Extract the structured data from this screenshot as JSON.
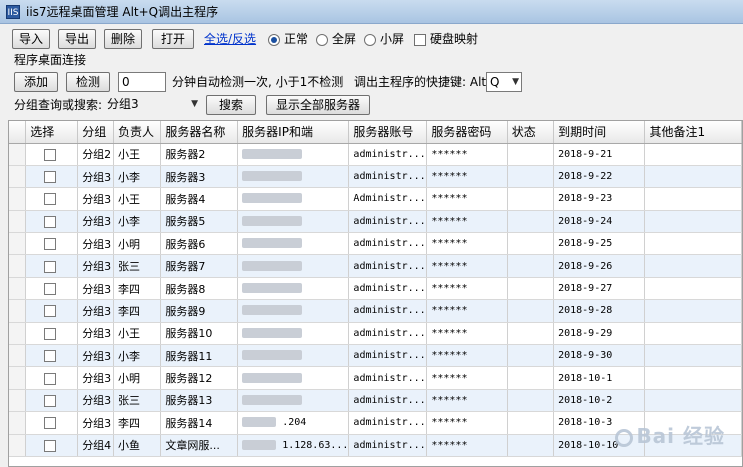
{
  "window": {
    "title": "iis7远程桌面管理 Alt+Q调出主程序",
    "icon": "app-icon"
  },
  "toolbar": {
    "import": "导入",
    "export": "导出",
    "delete": "删除",
    "open": "打开",
    "select_all": "全选/反选",
    "modes": [
      {
        "label": "正常",
        "selected": true
      },
      {
        "label": "全屏",
        "selected": false
      },
      {
        "label": "小屏",
        "selected": false
      }
    ],
    "disk_map": "硬盘映射"
  },
  "section": {
    "title": "程序桌面连接"
  },
  "row2": {
    "add": "添加",
    "check": "检测",
    "interval_value": "0",
    "interval_text": "分钟自动检测一次, 小于1不检测",
    "hotkey_text": "调出主程序的快捷键: Alt",
    "hotkey_value": "Q"
  },
  "row3": {
    "search_label": "分组查询或搜索:",
    "search_value": "分组3",
    "search_btn": "搜索",
    "show_all_btn": "显示全部服务器"
  },
  "table": {
    "headers": [
      "选择",
      "分组",
      "负责人",
      "服务器名称",
      "服务器IP和端",
      "服务器账号",
      "服务器密码",
      "状态",
      "到期时间",
      "其他备注1"
    ],
    "rows": [
      {
        "group": "分组2",
        "owner": "小王",
        "name": "服务器2",
        "ip": "",
        "account": "administr...",
        "password": "******",
        "status": "",
        "expire": "2018-9-21",
        "note": ""
      },
      {
        "group": "分组3",
        "owner": "小李",
        "name": "服务器3",
        "ip": "",
        "account": "administr...",
        "password": "******",
        "status": "",
        "expire": "2018-9-22",
        "note": ""
      },
      {
        "group": "分组3",
        "owner": "小王",
        "name": "服务器4",
        "ip": "",
        "account": "Administr...",
        "password": "******",
        "status": "",
        "expire": "2018-9-23",
        "note": ""
      },
      {
        "group": "分组3",
        "owner": "小李",
        "name": "服务器5",
        "ip": "",
        "account": "administr...",
        "password": "******",
        "status": "",
        "expire": "2018-9-24",
        "note": ""
      },
      {
        "group": "分组3",
        "owner": "小明",
        "name": "服务器6",
        "ip": "",
        "account": "administr...",
        "password": "******",
        "status": "",
        "expire": "2018-9-25",
        "note": ""
      },
      {
        "group": "分组3",
        "owner": "张三",
        "name": "服务器7",
        "ip": "",
        "account": "administr...",
        "password": "******",
        "status": "",
        "expire": "2018-9-26",
        "note": ""
      },
      {
        "group": "分组3",
        "owner": "李四",
        "name": "服务器8",
        "ip": "",
        "account": "administr...",
        "password": "******",
        "status": "",
        "expire": "2018-9-27",
        "note": ""
      },
      {
        "group": "分组3",
        "owner": "李四",
        "name": "服务器9",
        "ip": "",
        "account": "administr...",
        "password": "******",
        "status": "",
        "expire": "2018-9-28",
        "note": ""
      },
      {
        "group": "分组3",
        "owner": "小王",
        "name": "服务器10",
        "ip": "",
        "account": "administr...",
        "password": "******",
        "status": "",
        "expire": "2018-9-29",
        "note": ""
      },
      {
        "group": "分组3",
        "owner": "小李",
        "name": "服务器11",
        "ip": "",
        "account": "administr...",
        "password": "******",
        "status": "",
        "expire": "2018-9-30",
        "note": ""
      },
      {
        "group": "分组3",
        "owner": "小明",
        "name": "服务器12",
        "ip": "",
        "account": "administr...",
        "password": "******",
        "status": "",
        "expire": "2018-10-1",
        "note": ""
      },
      {
        "group": "分组3",
        "owner": "张三",
        "name": "服务器13",
        "ip": "",
        "account": "administr...",
        "password": "******",
        "status": "",
        "expire": "2018-10-2",
        "note": ""
      },
      {
        "group": "分组3",
        "owner": "李四",
        "name": "服务器14",
        "ip": ".204",
        "account": "administr...",
        "password": "******",
        "status": "",
        "expire": "2018-10-3",
        "note": ""
      },
      {
        "group": "分组4",
        "owner": "小鱼",
        "name": "文章网服...",
        "ip": "1.128.63...",
        "account": "administr...",
        "password": "******",
        "status": "",
        "expire": "2018-10-10",
        "note": ""
      }
    ]
  },
  "watermark": "Bai 经验"
}
